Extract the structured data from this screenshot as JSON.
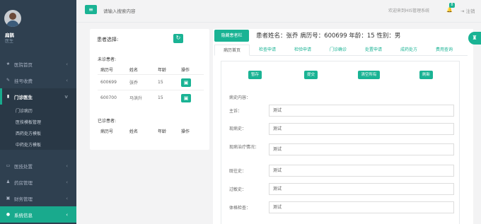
{
  "user": {
    "name": "扁鹊",
    "role": "医生"
  },
  "sidebar": {
    "items": [
      {
        "icon": "★",
        "label": "医院首页",
        "chev": "‹"
      },
      {
        "icon": "✎",
        "label": "挂号收费",
        "chev": "‹"
      },
      {
        "icon": "▮",
        "label": "门诊医生",
        "chev": "v"
      }
    ],
    "sub": [
      "门诊病历",
      "医技模板管理",
      "西药处方模板",
      "中药处方模板"
    ],
    "items2": [
      {
        "icon": "▭",
        "label": "医技处置",
        "chev": "‹"
      },
      {
        "icon": "♟",
        "label": "药房管理",
        "chev": "‹"
      },
      {
        "icon": "▣",
        "label": "财务管理",
        "chev": "‹"
      },
      {
        "icon": "●",
        "label": "系统信息",
        "chev": "‹"
      }
    ]
  },
  "topbar": {
    "menu_icon": "≡",
    "search_placeholder": "请输入搜索内容",
    "welcome": "欢迎来到HIS管理系统",
    "bell_icon": "🔔",
    "badge": "8",
    "logout_icon": "⇥",
    "logout": "注销"
  },
  "patient_select": {
    "title": "患者选择:",
    "refresh_icon": "↻",
    "pending_title": "未诊患者:",
    "done_title": "已诊患者:",
    "columns": [
      "病历号",
      "姓名",
      "年龄",
      "操作"
    ],
    "camera_icon": "▣",
    "pending": [
      {
        "id": "600699",
        "name": "张乔",
        "age": "15"
      },
      {
        "id": "600700",
        "name": "马洪升",
        "age": "15"
      }
    ]
  },
  "record": {
    "hide_label": "隐藏患者栏",
    "patient_info": "患者姓名：张乔 病历号：600699 年龄：15 性别：男",
    "tabs": [
      "病历首页",
      "检查申请",
      "检验申请",
      "门诊确诊",
      "处置申请",
      "成药处方",
      "费用查询"
    ],
    "actions": [
      "暂存",
      "提交",
      "清空所有",
      "刷新"
    ],
    "section_label": "病史内容：",
    "fields": [
      {
        "label": "主诉：",
        "value": "测试"
      },
      {
        "label": "现病史：",
        "value": "测试"
      },
      {
        "label": "现病治疗情况：",
        "value": "测试"
      },
      {
        "label": "既往史：",
        "value": "测试"
      },
      {
        "label": "过敏史：",
        "value": "测试"
      },
      {
        "label": "体格检查：",
        "value": "测试"
      }
    ]
  },
  "side_tab": {
    "icon": "♜"
  }
}
